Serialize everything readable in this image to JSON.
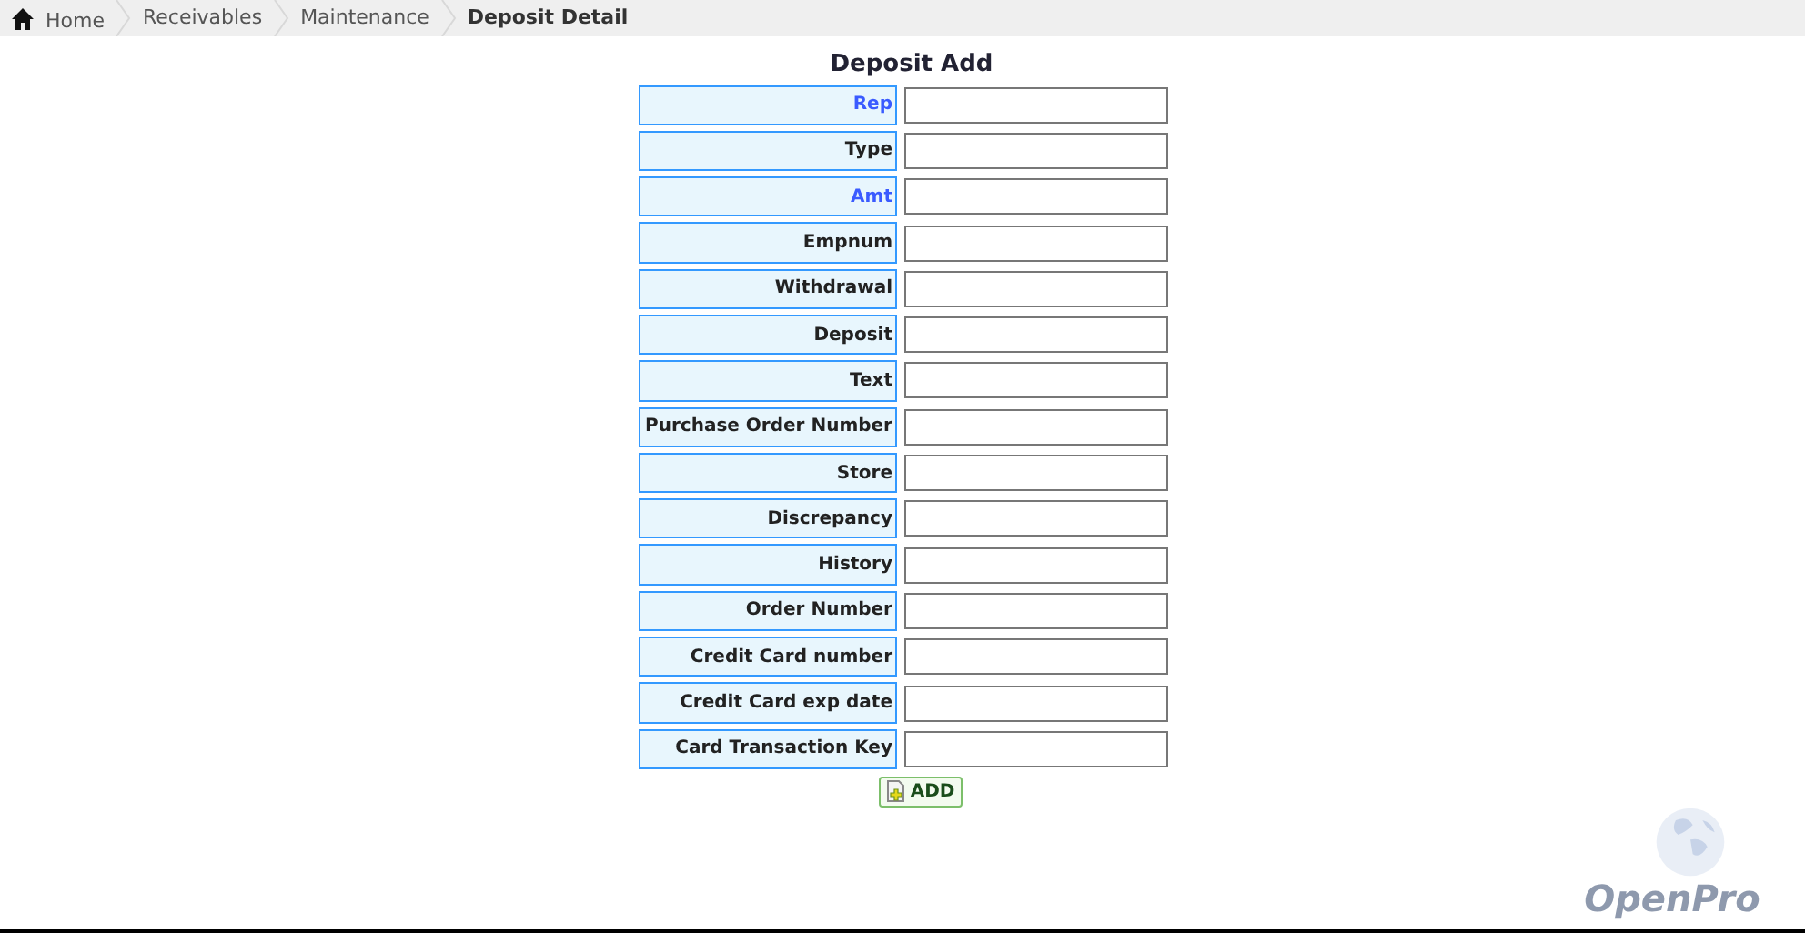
{
  "breadcrumbs": [
    {
      "label": "Home",
      "kind": "home",
      "selected": false
    },
    {
      "label": "Receivables",
      "kind": "link",
      "selected": false
    },
    {
      "label": "Maintenance",
      "kind": "link",
      "selected": false
    },
    {
      "label": "Deposit Detail",
      "kind": "link",
      "selected": true
    }
  ],
  "form": {
    "title": "Deposit Add",
    "fields": [
      {
        "label": "Rep",
        "required": true
      },
      {
        "label": "Type",
        "required": false
      },
      {
        "label": "Amt",
        "required": true
      },
      {
        "label": "Empnum",
        "required": false
      },
      {
        "label": "Withdrawal",
        "required": false
      },
      {
        "label": "Deposit",
        "required": false
      },
      {
        "label": "Text",
        "required": false
      },
      {
        "label": "Purchase Order Number",
        "required": false
      },
      {
        "label": "Store",
        "required": false
      },
      {
        "label": "Discrepancy",
        "required": false
      },
      {
        "label": "History",
        "required": false
      },
      {
        "label": "Order Number",
        "required": false
      },
      {
        "label": "Credit Card number",
        "required": false
      },
      {
        "label": "Credit Card exp date",
        "required": false
      },
      {
        "label": "Card Transaction Key",
        "required": false
      }
    ],
    "button": "ADD"
  },
  "logo": {
    "text": "OpenPro"
  }
}
